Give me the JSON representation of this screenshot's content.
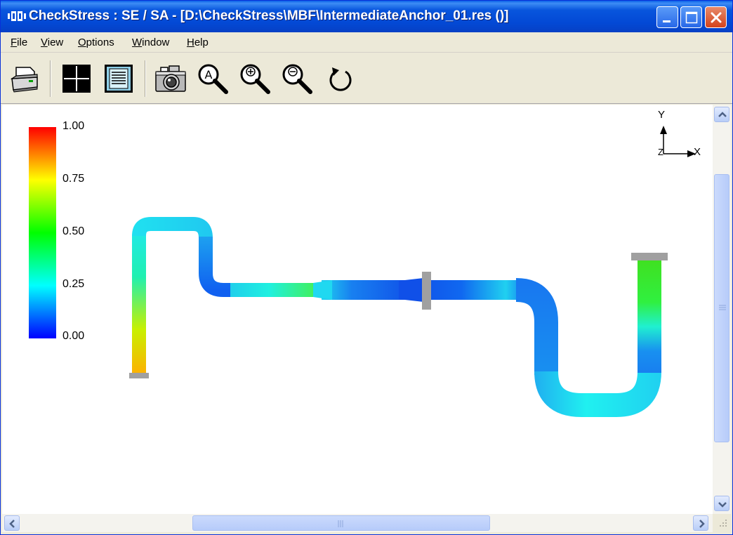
{
  "window": {
    "title": "CheckStress : SE / SA -  [D:\\CheckStress\\MBF\\IntermediateAnchor_01.res ()]",
    "accent_color": "#0A5FE8"
  },
  "menu": {
    "items": [
      {
        "label": "File"
      },
      {
        "label": "View"
      },
      {
        "label": "Options"
      },
      {
        "label": "Window"
      },
      {
        "label": "Help"
      }
    ]
  },
  "toolbar": {
    "buttons": [
      {
        "icon": "printer-icon"
      },
      {
        "icon": "crosshair-view-icon"
      },
      {
        "icon": "report-list-icon"
      },
      {
        "icon": "camera-icon"
      },
      {
        "icon": "zoom-auto-icon"
      },
      {
        "icon": "zoom-in-icon"
      },
      {
        "icon": "zoom-out-icon"
      },
      {
        "icon": "rotate-reset-icon"
      }
    ]
  },
  "legend": {
    "labels": [
      "1.00",
      "0.75",
      "0.50",
      "0.25",
      "0.00"
    ],
    "colors": [
      "#FF0000",
      "#FFFF00",
      "#00FF00",
      "#00FFFF",
      "#0000FF"
    ]
  },
  "axes": {
    "y_label": "Y",
    "x_label": "X",
    "z_label": "Z"
  }
}
